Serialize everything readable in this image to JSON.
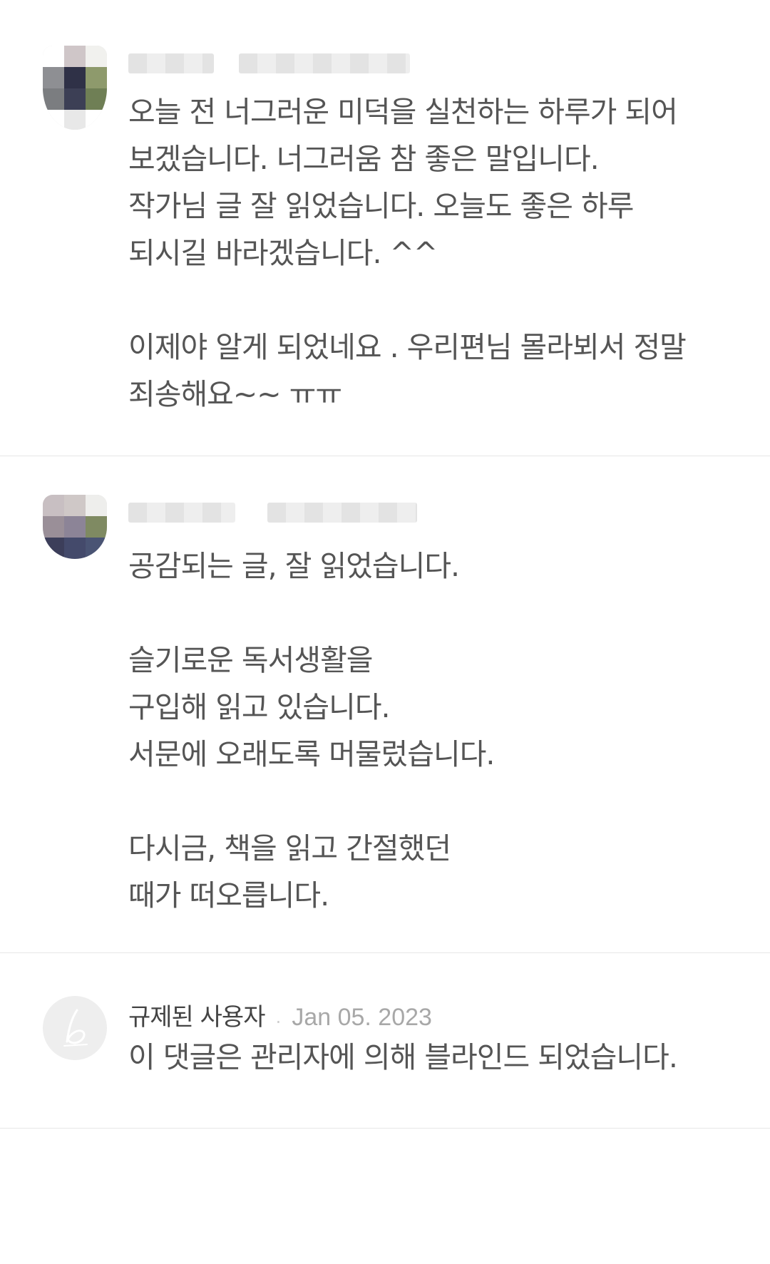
{
  "comments": [
    {
      "author": "",
      "date": "",
      "paragraphs": [
        "오늘 전 너그러운 미덕을 실천하는 하루가 되어\n보겠습니다. 너그러움 참 좋은 말입니다.\n작가님 글 잘 읽었습니다. 오늘도 좋은 하루\n되시길 바라겠습니다. ^^",
        "이제야 알게 되었네요 . 우리편님 몰라뵈서 정말\n죄송해요~~ ㅠㅠ"
      ]
    },
    {
      "author": "",
      "date": "",
      "paragraphs": [
        "공감되는 글, 잘 읽었습니다.",
        "슬기로운 독서생활을\n구입해 읽고 있습니다.\n서문에 오래도록 머물렀습니다.",
        "다시금, 책을 읽고 간절했던\n때가 떠오릅니다."
      ]
    },
    {
      "author": "규제된 사용자",
      "separator": "·",
      "date": "Jan 05. 2023",
      "paragraphs": [
        "이 댓글은 관리자에 의해 블라인드 되었습니다."
      ]
    }
  ],
  "colors": {
    "text": "#555555",
    "date": "#a8a8a8",
    "divider": "#e6e6e6",
    "default_avatar": "#eeeeee"
  }
}
